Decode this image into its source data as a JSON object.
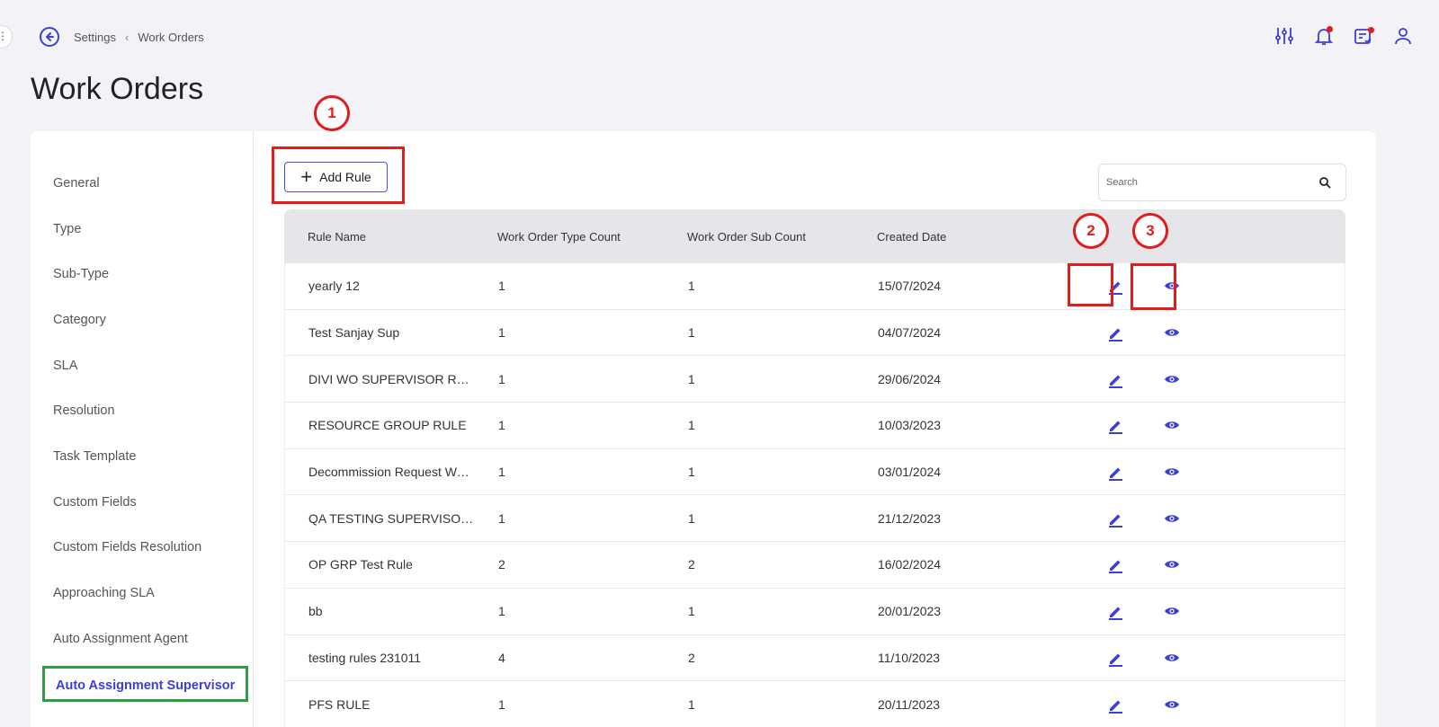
{
  "breadcrumb": {
    "parent": "Settings",
    "current": "Work Orders"
  },
  "page_title": "Work Orders",
  "sidebar": {
    "items": [
      {
        "label": "General"
      },
      {
        "label": "Type"
      },
      {
        "label": "Sub-Type"
      },
      {
        "label": "Category"
      },
      {
        "label": "SLA"
      },
      {
        "label": "Resolution"
      },
      {
        "label": "Task Template"
      },
      {
        "label": "Custom Fields"
      },
      {
        "label": "Custom Fields Resolution"
      },
      {
        "label": "Approaching SLA"
      },
      {
        "label": "Auto Assignment Agent"
      },
      {
        "label": "Auto Assignment Supervisor"
      }
    ],
    "active": "Auto Assignment Supervisor"
  },
  "toolbar": {
    "add_rule_label": "Add Rule"
  },
  "search": {
    "placeholder": "Search"
  },
  "annotations": {
    "one": "1",
    "two": "2",
    "three": "3"
  },
  "table": {
    "headers": [
      "Rule Name",
      "Work Order Type Count",
      "Work Order Sub Count",
      "Created Date"
    ],
    "rows": [
      {
        "name": "yearly 12",
        "type_count": "1",
        "sub_count": "1",
        "date": "15/07/2024"
      },
      {
        "name": "Test Sanjay Sup",
        "type_count": "1",
        "sub_count": "1",
        "date": "04/07/2024"
      },
      {
        "name": "DIVI WO SUPERVISOR RULE",
        "type_count": "1",
        "sub_count": "1",
        "date": "29/06/2024"
      },
      {
        "name": "RESOURCE GROUP RULE",
        "type_count": "1",
        "sub_count": "1",
        "date": "10/03/2023"
      },
      {
        "name": "Decommission Request Work...",
        "type_count": "1",
        "sub_count": "1",
        "date": "03/01/2024"
      },
      {
        "name": "QA TESTING SUPERVISOR AA",
        "type_count": "1",
        "sub_count": "1",
        "date": "21/12/2023"
      },
      {
        "name": "OP GRP Test Rule",
        "type_count": "2",
        "sub_count": "2",
        "date": "16/02/2024"
      },
      {
        "name": "bb",
        "type_count": "1",
        "sub_count": "1",
        "date": "20/01/2023"
      },
      {
        "name": "testing rules 231011",
        "type_count": "4",
        "sub_count": "2",
        "date": "11/10/2023"
      },
      {
        "name": "PFS RULE",
        "type_count": "1",
        "sub_count": "1",
        "date": "20/11/2023"
      }
    ]
  },
  "colors": {
    "accent": "#3b3fd8",
    "annotation_red": "#e21b1b",
    "active_outline": "#2ea043"
  }
}
